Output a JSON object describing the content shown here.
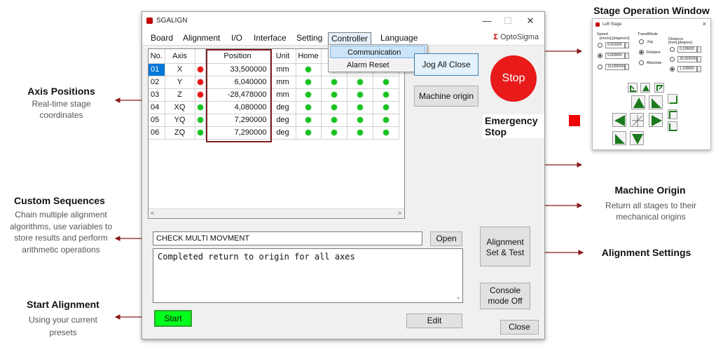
{
  "stage_window": {
    "heading": "Stage Operation Window",
    "title": "Left Stage",
    "close_icon": "×",
    "speed_label": "Speed",
    "speed_unit": "[mm/s],[degree/s]",
    "speed_values": [
      "0,001000",
      "5,000000",
      "10,000000"
    ],
    "speed_selected": 1,
    "travel_mode_label": "TravelMode",
    "travel_modes": [
      "Jog",
      "Relative",
      "Absolute"
    ],
    "travel_selected": 1,
    "distance_label": "Distance",
    "distance_unit": "[mm],[degree]",
    "distance_values": [
      "6,195000",
      "33,502000",
      "1,100000"
    ],
    "distance_selected": 2
  },
  "annotations": {
    "axis_positions": {
      "title": "Axis Positions",
      "subtitle": "Real-time stage coordinates"
    },
    "custom_sequences": {
      "title": "Custom Sequences",
      "subtitle": "Chain multiple alignment algorithms, use variables to store results and perform arithmetic operations"
    },
    "start_alignment": {
      "title": "Start Alignment",
      "subtitle": "Using your current presets"
    },
    "machine_origin": {
      "title": "Machine Origin",
      "subtitle": "Return all stages to their mechanical origins"
    },
    "alignment_settings": {
      "title": "Alignment Settings"
    },
    "emergency_stop": {
      "title": "Emergency Stop"
    }
  },
  "app": {
    "title": "SGALIGN",
    "logo_mark": "Σ",
    "logo_text": "OptoSigma",
    "minimize_icon": "—",
    "maximize_icon": "☐",
    "close_icon": "✕"
  },
  "menu": [
    "Board",
    "Alignment",
    "I/O",
    "Interface",
    "Setting",
    "Controller",
    "Language"
  ],
  "menu_active": "Controller",
  "controller_menu": [
    "Communication",
    "Alarm Reset"
  ],
  "table": {
    "headers": [
      "No.",
      "Axis",
      "",
      "Position",
      "Unit",
      "Home",
      "",
      "",
      ""
    ],
    "rows": [
      {
        "no": "01",
        "axis": "X",
        "status": "red",
        "position": "33,500000",
        "unit": "mm"
      },
      {
        "no": "02",
        "axis": "Y",
        "status": "red",
        "position": "6,040000",
        "unit": "mm"
      },
      {
        "no": "03",
        "axis": "Z",
        "status": "red",
        "position": "-28,478000",
        "unit": "mm"
      },
      {
        "no": "04",
        "axis": "XQ",
        "status": "green",
        "position": "4,080000",
        "unit": "deg"
      },
      {
        "no": "05",
        "axis": "YQ",
        "status": "green",
        "position": "7,290000",
        "unit": "deg"
      },
      {
        "no": "06",
        "axis": "ZQ",
        "status": "green",
        "position": "7,290000",
        "unit": "deg"
      }
    ],
    "scroll_left": "<",
    "scroll_right": ">"
  },
  "buttons": {
    "jog_all_close": "Jog All Close",
    "stop": "Stop",
    "machine_origin": "Machine origin",
    "open": "Open",
    "alignment_set_test": [
      "Alignment",
      "Set & Test"
    ],
    "console_mode": [
      "Console",
      "mode Off"
    ],
    "start": "Start",
    "edit": "Edit",
    "close": "Close"
  },
  "sequence_name": "CHECK MULTI MOVMENT",
  "console_text": "Completed return to origin for all axes",
  "console_scroll": "⌄",
  "colors": {
    "accent_red": "#e81a1a",
    "start_green": "#00ff1a",
    "arrow_red": "#8b1a1a",
    "stage_green": "#1c7a1c"
  }
}
